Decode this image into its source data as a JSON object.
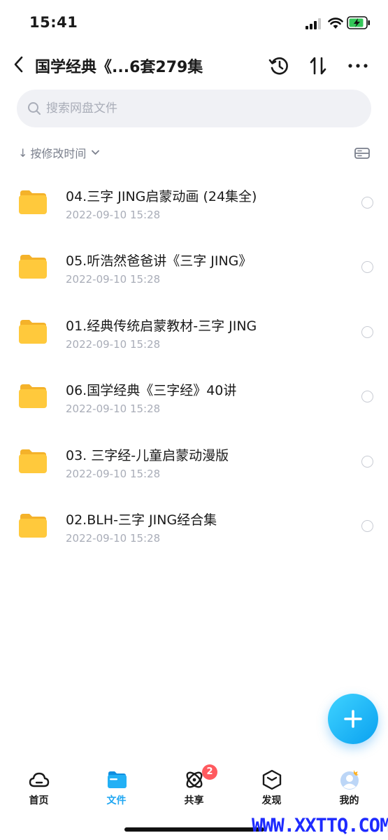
{
  "status_bar": {
    "time": "15:41"
  },
  "header": {
    "title": "国学经典《...6套279集"
  },
  "search": {
    "placeholder": "搜索网盘文件"
  },
  "sort": {
    "label": "按修改时间"
  },
  "files": [
    {
      "name": "04.三字 JING启蒙动画 (24集全)",
      "modified": "2022-09-10 15:28"
    },
    {
      "name": "05.听浩然爸爸讲《三字 JING》",
      "modified": "2022-09-10 15:28"
    },
    {
      "name": "01.经典传统启蒙教材-三字 JING",
      "modified": "2022-09-10 15:28"
    },
    {
      "name": "06.国学经典《三字经》40讲",
      "modified": "2022-09-10 15:28"
    },
    {
      "name": "03. 三字经-儿童启蒙动漫版",
      "modified": "2022-09-10 15:28"
    },
    {
      "name": "02.BLH-三字 JING经合集",
      "modified": "2022-09-10 15:28"
    }
  ],
  "tabs": [
    {
      "label": "首页",
      "icon": "cloud-icon"
    },
    {
      "label": "文件",
      "icon": "folder-icon"
    },
    {
      "label": "共享",
      "icon": "orbit-icon"
    },
    {
      "label": "发现",
      "icon": "cube-icon"
    },
    {
      "label": "我的",
      "icon": "avatar-icon"
    }
  ],
  "share_badge": "2",
  "watermark": "WWW.XXTTQ.COM",
  "colors": {
    "accent": "#1ea6f2",
    "folder": "#ffc93c",
    "badge": "#ff5a5f"
  }
}
